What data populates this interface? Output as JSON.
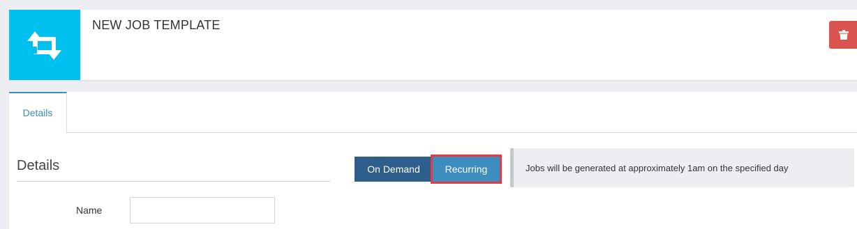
{
  "header": {
    "title": "NEW JOB TEMPLATE",
    "icon": "recurring-arrows-icon",
    "icon_bg_color": "#00c0ef",
    "delete_icon": "trash-icon",
    "delete_color": "#d9534f"
  },
  "tabs": [
    {
      "label": "Details",
      "active": true
    }
  ],
  "details_section": {
    "title": "Details",
    "fields": [
      {
        "label": "Name",
        "value": "",
        "placeholder": ""
      }
    ]
  },
  "schedule_toggle": {
    "options": [
      {
        "label": "On Demand",
        "selected": false
      },
      {
        "label": "Recurring",
        "selected": true
      }
    ],
    "highlight_color": "#e53945"
  },
  "info_message": "Jobs will be generated at approximately 1am on the specified day"
}
